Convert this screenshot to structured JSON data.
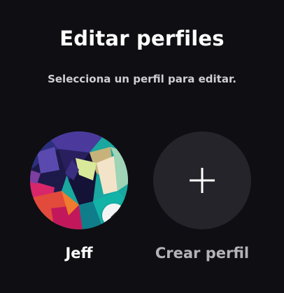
{
  "header": {
    "title": "Editar perfiles",
    "subtitle": "Selecciona un perfil para editar."
  },
  "profiles": [
    {
      "name": "Jeff",
      "avatar_icon": "geometric-knight-avatar",
      "edit_icon": "pencil-icon"
    }
  ],
  "create": {
    "label": "Crear perfil",
    "icon": "plus-icon"
  },
  "colors": {
    "background": "#0f0e13",
    "create_circle": "#25242a",
    "title": "#ffffff",
    "subtitle": "#cfcfd3",
    "create_label": "#b3b3b8"
  }
}
